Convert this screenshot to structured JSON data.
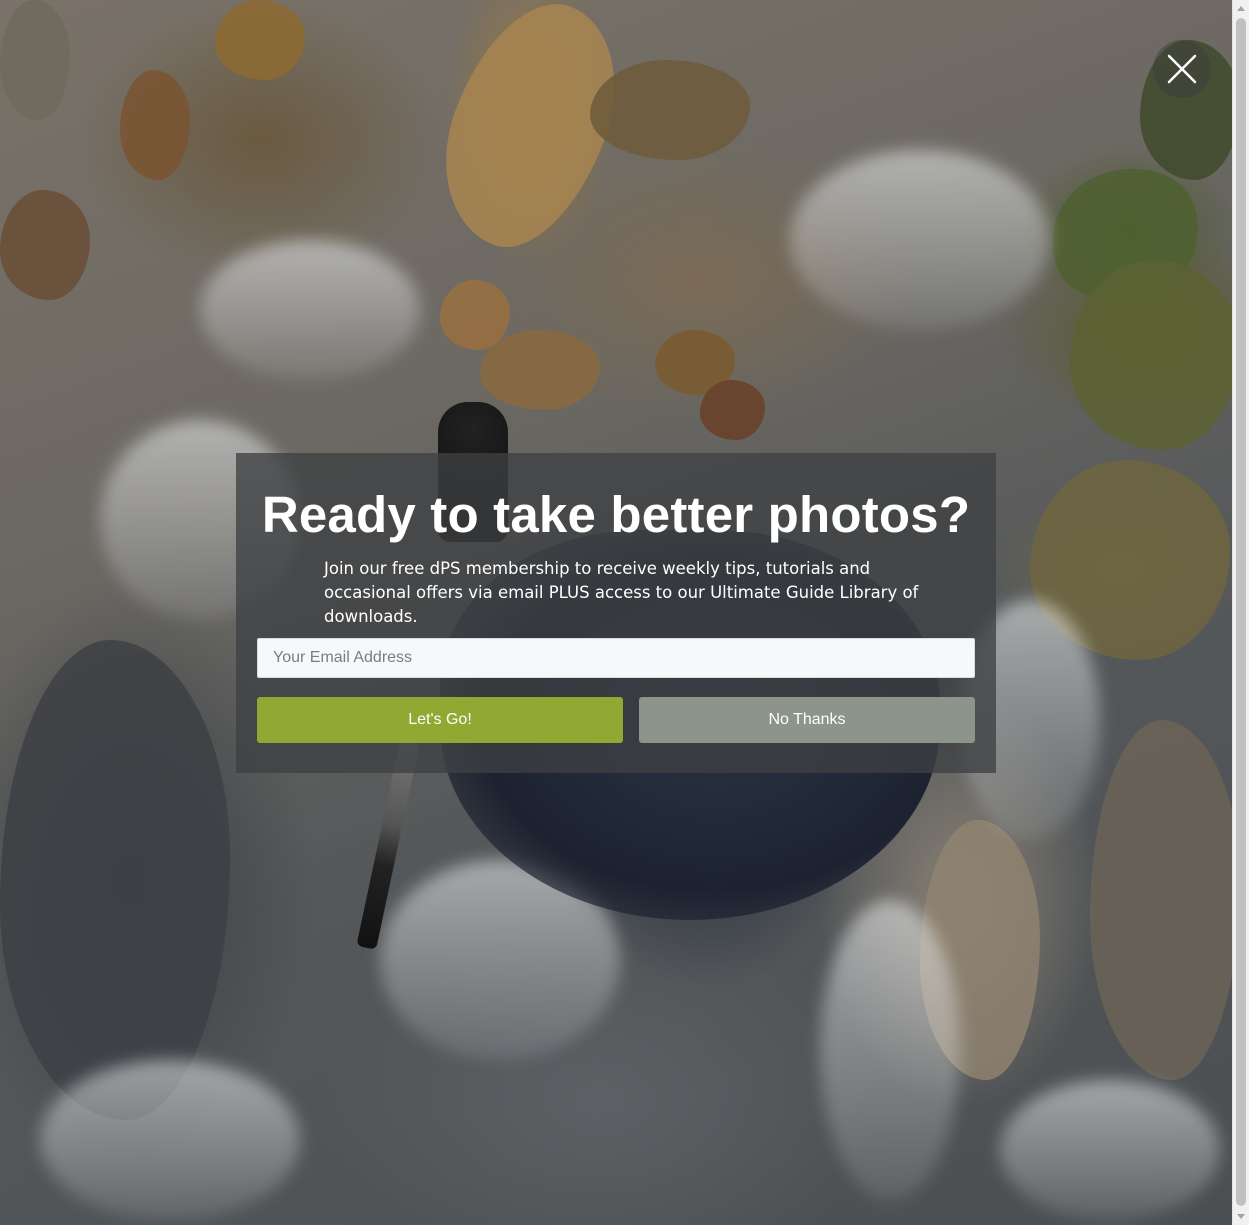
{
  "popup": {
    "title": "Ready to take better photos?",
    "description": "Join our free dPS membership to receive weekly tips, tutorials and occasional offers via email PLUS access to our Ultimate Guide Library of downloads.",
    "email_placeholder": "Your Email Address",
    "email_value": "",
    "primary_button_label": "Let's Go!",
    "secondary_button_label": "No Thanks",
    "primary_color": "#93a832",
    "secondary_color": "#8d958a"
  },
  "icons": {
    "close": "close-icon"
  }
}
